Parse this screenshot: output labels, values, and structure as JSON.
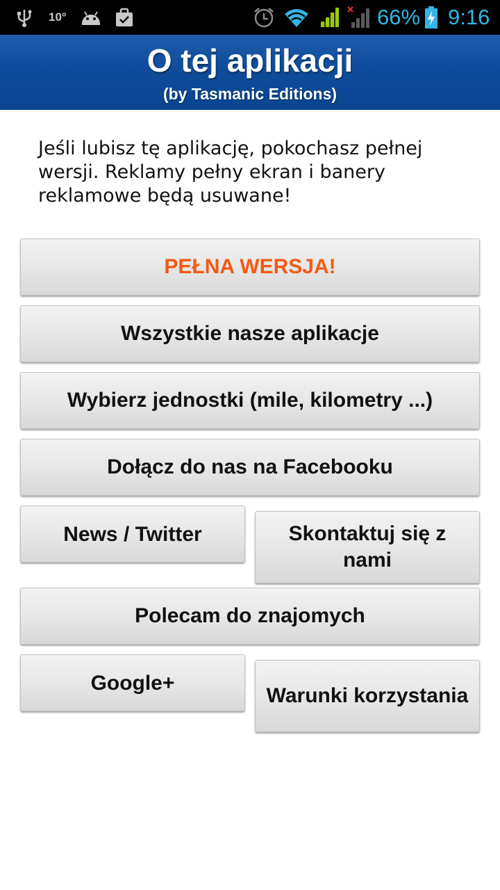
{
  "status_bar": {
    "temperature": "10°",
    "battery_percent": "66%",
    "time": "9:16",
    "icons": [
      "usb-icon",
      "android-icon",
      "bag-icon",
      "alarm-icon",
      "wifi-icon",
      "signal-icon",
      "signal-no-service-icon",
      "battery-charging-icon"
    ],
    "accent_color": "#33b5e5"
  },
  "header": {
    "title": "O tej aplikacji",
    "subtitle": "(by Tasmanic Editions)",
    "background_color": "#0f4d9c"
  },
  "intro_text": "Jeśli lubisz tę aplikację, pokochasz pełnej wersji. Reklamy pełny ekran i banery reklamowe będą usuwane!",
  "buttons": {
    "full_version": "PEŁNA WERSJA!",
    "all_apps": "Wszystkie nasze aplikacje",
    "choose_units": "Wybierz jednostki (mile, kilometry ...)",
    "join_facebook": "Dołącz do nas na Facebooku",
    "news_twitter": "News / Twitter",
    "contact_us": "Skontaktuj się z nami",
    "recommend": "Polecam do znajomych",
    "google_plus": "Google+",
    "terms": "Warunki korzystania"
  },
  "colors": {
    "full_version_text": "#f25a14",
    "button_text": "#111111"
  }
}
